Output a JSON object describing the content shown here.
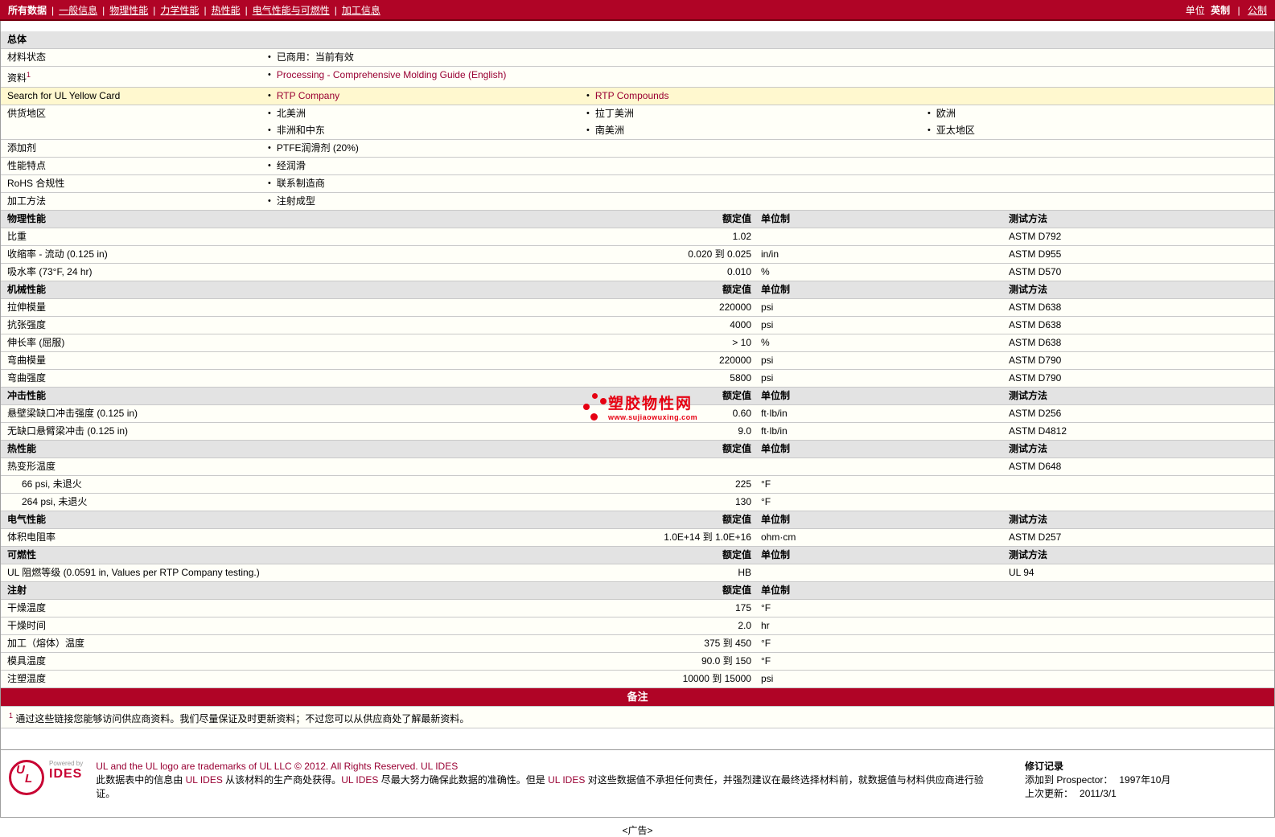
{
  "nav": {
    "items": [
      {
        "label": "所有数据",
        "active": true
      },
      {
        "label": "一般信息"
      },
      {
        "label": "物理性能"
      },
      {
        "label": "力学性能"
      },
      {
        "label": "热性能"
      },
      {
        "label": "电气性能与可燃性"
      },
      {
        "label": "加工信息"
      }
    ],
    "units_label": "单位",
    "unit_current": "英制",
    "unit_alt": "公制"
  },
  "table": {
    "value_header": "额定值",
    "unit_header": "单位制",
    "method_header": "测试方法",
    "sections": [
      {
        "title": "总体",
        "type": "info",
        "rows": [
          {
            "label": "材料状态",
            "cols": [
              [
                "已商用：当前有效"
              ]
            ]
          },
          {
            "label": "资料",
            "sup": "1",
            "links": true,
            "cols": [
              [
                "Processing - Comprehensive Molding Guide (English)"
              ]
            ]
          },
          {
            "label": "Search for UL Yellow Card",
            "highlight": true,
            "links": true,
            "cols": [
              [
                "RTP Company"
              ],
              [
                "RTP Compounds"
              ]
            ]
          },
          {
            "label": "供货地区",
            "cols": [
              [
                "北美洲",
                "非洲和中东"
              ],
              [
                "拉丁美洲",
                "南美洲"
              ],
              [
                "欧洲",
                "亚太地区"
              ]
            ]
          },
          {
            "label": "添加剂",
            "cols": [
              [
                "PTFE润滑剂  (20%)"
              ]
            ]
          },
          {
            "label": "性能特点",
            "cols": [
              [
                "经润滑"
              ]
            ]
          },
          {
            "label": "RoHS 合规性",
            "cols": [
              [
                "联系制造商"
              ]
            ]
          },
          {
            "label": "加工方法",
            "cols": [
              [
                "注射成型"
              ]
            ]
          }
        ]
      },
      {
        "title": "物理性能",
        "type": "props",
        "has_method": true,
        "rows": [
          {
            "label": "比重",
            "value": "1.02",
            "unit": "",
            "method": "ASTM D792"
          },
          {
            "label": "收缩率  - 流动  (0.125 in)",
            "value": "0.020 到  0.025",
            "unit": "in/in",
            "method": "ASTM D955"
          },
          {
            "label": "吸水率  (73°F, 24 hr)",
            "value": "0.010",
            "unit": "%",
            "method": "ASTM D570"
          }
        ]
      },
      {
        "title": "机械性能",
        "type": "props",
        "has_method": true,
        "rows": [
          {
            "label": "拉伸模量",
            "value": "220000",
            "unit": "psi",
            "method": "ASTM D638"
          },
          {
            "label": "抗张强度",
            "value": "4000",
            "unit": "psi",
            "method": "ASTM D638"
          },
          {
            "label": "伸长率  (屈服)",
            "value": "> 10",
            "unit": "%",
            "method": "ASTM D638"
          },
          {
            "label": "弯曲模量",
            "value": "220000",
            "unit": "psi",
            "method": "ASTM D790"
          },
          {
            "label": "弯曲强度",
            "value": "5800",
            "unit": "psi",
            "method": "ASTM D790"
          }
        ]
      },
      {
        "title": "冲击性能",
        "type": "props",
        "has_method": true,
        "rows": [
          {
            "label": "悬壁梁缺口冲击强度  (0.125 in)",
            "value": "0.60",
            "unit": "ft·lb/in",
            "method": "ASTM D256"
          },
          {
            "label": "无缺口悬臂梁冲击  (0.125 in)",
            "value": "9.0",
            "unit": "ft·lb/in",
            "method": "ASTM D4812"
          }
        ]
      },
      {
        "title": "热性能",
        "type": "props",
        "has_method": true,
        "rows": [
          {
            "label": "热变形温度",
            "value": "",
            "unit": "",
            "method": "ASTM D648"
          },
          {
            "label": "66 psi, 未退火",
            "indent": true,
            "value": "225",
            "unit": "°F",
            "method": ""
          },
          {
            "label": "264 psi, 未退火",
            "indent": true,
            "value": "130",
            "unit": "°F",
            "method": ""
          }
        ]
      },
      {
        "title": "电气性能",
        "type": "props",
        "has_method": true,
        "rows": [
          {
            "label": "体积电阻率",
            "value": "1.0E+14 到  1.0E+16",
            "unit": "ohm·cm",
            "method": "ASTM D257"
          }
        ]
      },
      {
        "title": "可燃性",
        "type": "props",
        "has_method": true,
        "rows": [
          {
            "label": "UL 阻燃等级  (0.0591 in, Values per RTP Company testing.)",
            "value": "HB",
            "unit": "",
            "method": "UL 94"
          }
        ]
      },
      {
        "title": "注射",
        "type": "props",
        "has_method": false,
        "rows": [
          {
            "label": "干燥温度",
            "value": "175",
            "unit": "°F",
            "method": ""
          },
          {
            "label": "干燥时间",
            "value": "2.0",
            "unit": "hr",
            "method": ""
          },
          {
            "label": "加工（熔体）温度",
            "value": "375 到  450",
            "unit": "°F",
            "method": ""
          },
          {
            "label": "模具温度",
            "value": "90.0 到  150",
            "unit": "°F",
            "method": ""
          },
          {
            "label": "注塑温度",
            "value": "10000 到  15000",
            "unit": "psi",
            "method": ""
          }
        ]
      }
    ]
  },
  "notes": {
    "bar": "备注",
    "footnote_sup": "1",
    "footnote": "通过这些链接您能够访问供应商资料。我们尽量保证及时更新资料；不过您可以从供应商处了解最新资料。"
  },
  "watermark": {
    "title": "塑胶物性网",
    "url": "www.sujiaowuxing.com"
  },
  "footer": {
    "logo_text_u": "U",
    "logo_text_l": "L",
    "powered_by": "Powered by",
    "brand": "IDES",
    "trademark_line": "UL and the UL logo are trademarks of UL LLC © 2012. All Rights Reserved. UL IDES",
    "disclaimer_segments": [
      {
        "t": "此数据表中的信息由  ",
        "link": false
      },
      {
        "t": "UL IDES",
        "link": true
      },
      {
        "t": " 从该材料的生产商处获得。",
        "link": false
      },
      {
        "t": "UL IDES",
        "link": true
      },
      {
        "t": " 尽最大努力确保此数据的准确性。但是  ",
        "link": false
      },
      {
        "t": "UL IDES",
        "link": true
      },
      {
        "t": " 对这些数据值不承担任何责任，并强烈建议在最终选择材料前，就数据值与材料供应商进行验证。",
        "link": false
      }
    ],
    "revision_title": "修订记录",
    "added_label": "添加到  Prospector：",
    "added_value": "1997年10月",
    "updated_label": "上次更新：",
    "updated_value": "2011/3/1"
  },
  "ad": "<广告>"
}
